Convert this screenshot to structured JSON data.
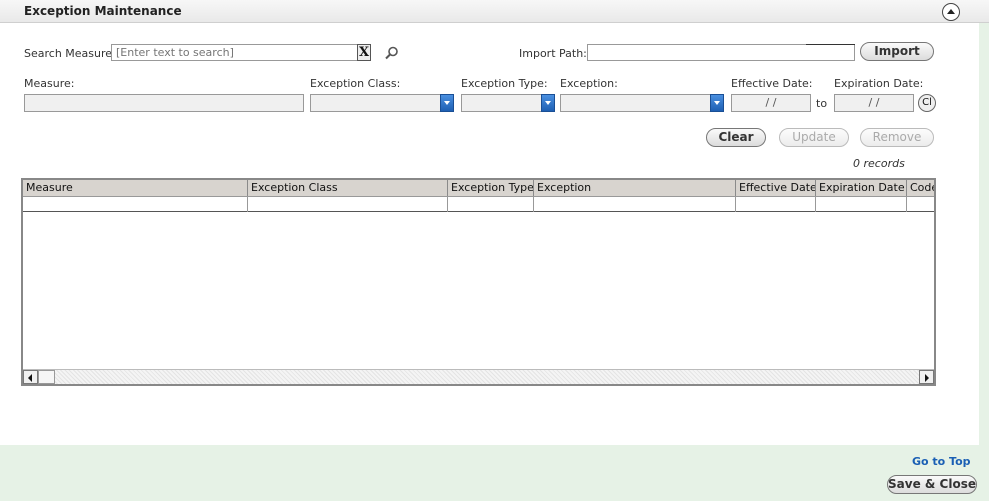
{
  "header": {
    "title": "Exception Maintenance"
  },
  "search": {
    "label": "Search Measure:",
    "placeholder": "[Enter text to search]",
    "clear_label": "X"
  },
  "import": {
    "label": "Import Path:",
    "value": "",
    "button_label": "Import"
  },
  "filters": {
    "measure_label": "Measure:",
    "exception_class_label": "Exception Class:",
    "exception_type_label": "Exception Type:",
    "exception_label": "Exception:",
    "effective_date_label": "Effective Date:",
    "expiration_date_label": "Expiration Date:",
    "effective_date_value": "/ /",
    "expiration_date_value": "/ /",
    "to_label": "to",
    "calendar_button_label": "Cl"
  },
  "actions": {
    "clear": "Clear",
    "update": "Update",
    "remove": "Remove"
  },
  "records_text": "0 records",
  "grid": {
    "columns": [
      "Measure",
      "Exception Class",
      "Exception Type",
      "Exception",
      "Effective Date",
      "Expiration Date",
      "Code"
    ]
  },
  "footer": {
    "goto_top": "Go to Top",
    "save_close": "Save & Close"
  },
  "colors": {
    "accent_blue": "#1a5fb4",
    "page_bg": "#e6f2e6",
    "grid_header": "#d8d4cf"
  }
}
